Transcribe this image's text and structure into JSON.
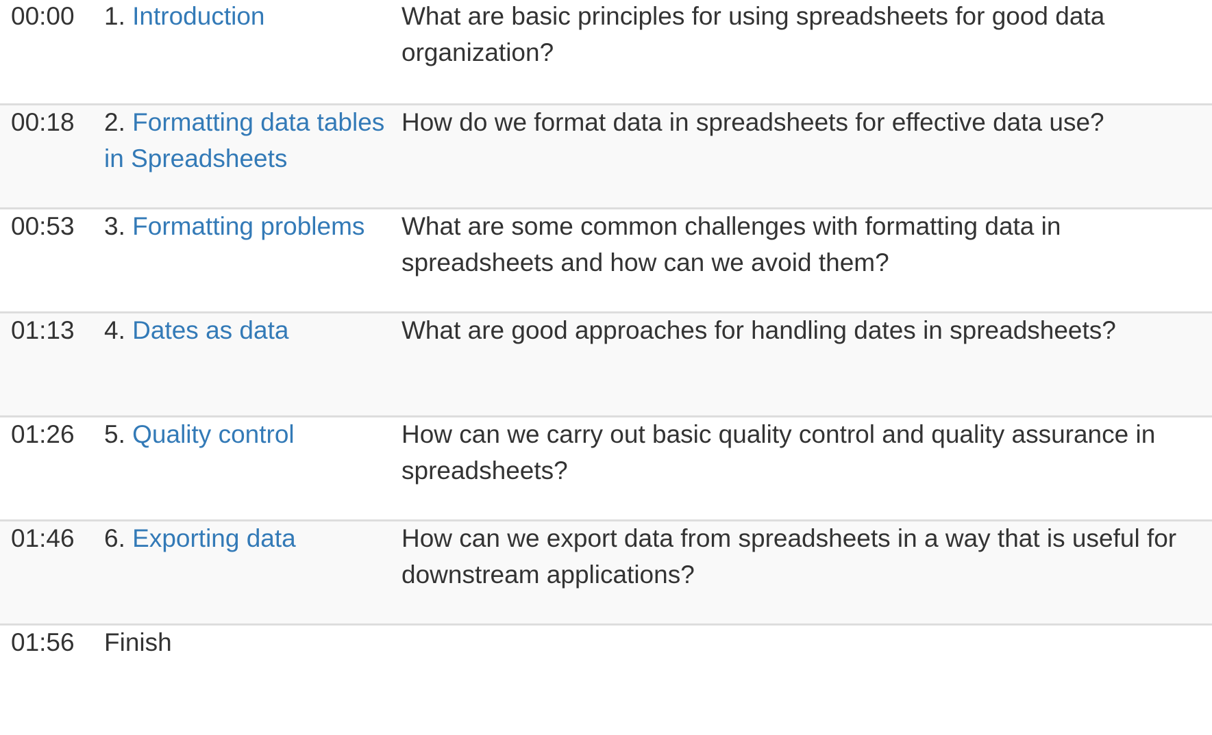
{
  "schedule": {
    "rows": [
      {
        "time": "00:00",
        "number": "1.",
        "title": "Introduction",
        "question": "What are basic principles for using spreadsheets for good data organization?"
      },
      {
        "time": "00:18",
        "number": "2.",
        "title": "Formatting data tables in Spreadsheets",
        "question": "How do we format data in spreadsheets for effective data use?"
      },
      {
        "time": "00:53",
        "number": "3.",
        "title": "Formatting problems",
        "question": "What are some common challenges with formatting data in spreadsheets and how can we avoid them?"
      },
      {
        "time": "01:13",
        "number": "4.",
        "title": "Dates as data",
        "question": "What are good approaches for handling dates in spreadsheets?"
      },
      {
        "time": "01:26",
        "number": "5.",
        "title": "Quality control",
        "question": "How can we carry out basic quality control and quality assurance in spreadsheets?"
      },
      {
        "time": "01:46",
        "number": "6.",
        "title": "Exporting data",
        "question": "How can we export data from spreadsheets in a way that is useful for downstream applications?"
      },
      {
        "time": "01:56",
        "finish": "Finish"
      }
    ],
    "colors": {
      "link": "#337ab7",
      "text": "#333333",
      "stripe": "#f9f9f9",
      "border": "#dddddd"
    }
  }
}
